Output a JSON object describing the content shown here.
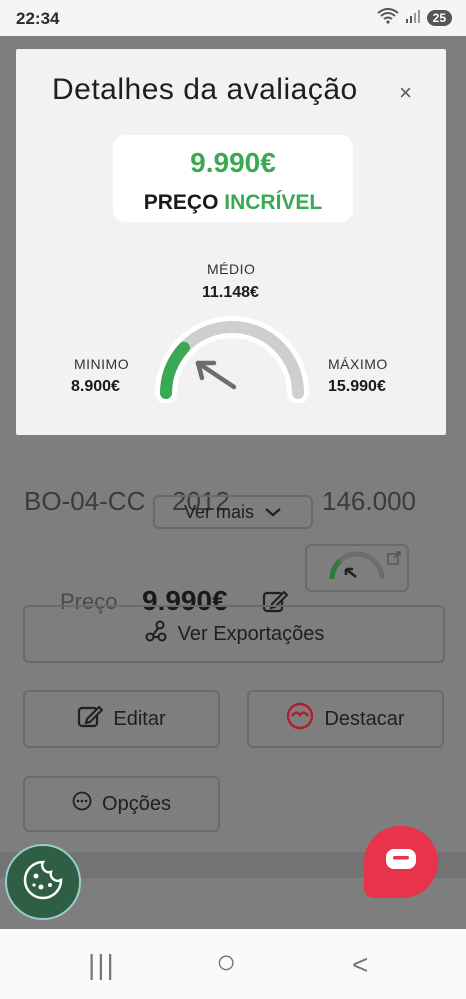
{
  "status": {
    "time": "22:34",
    "battery": "25"
  },
  "background": {
    "row_left": "BO-04-CC",
    "row_mid": "2012",
    "row_right": "146.000",
    "ver_mais": "Ver mais",
    "preco_label": "Preço",
    "preco_value": "9.990€",
    "ver_exportacoes": "Ver Exportações",
    "editar": "Editar",
    "destacar": "Destacar",
    "opcoes": "Opções"
  },
  "modal": {
    "title": "Detalhes da avaliação",
    "close": "×",
    "price": "9.990€",
    "tag_prefix": "PREÇO",
    "tag_highlight": "INCRÍVEL",
    "medio_label": "MÉDIO",
    "medio_value": "11.148€",
    "min_label": "MINIMO",
    "min_value": "8.900€",
    "max_label": "MÁXIMO",
    "max_value": "15.990€",
    "gauge_fill_fraction": 0.24,
    "colors": {
      "accent": "#3aa953",
      "track": "#cfcfcf"
    }
  },
  "nav": {
    "recent": "|||",
    "home": "○",
    "back": "<"
  },
  "icons": {
    "close": "close-icon",
    "chevron": "chevron-down-icon",
    "edit": "edit-icon",
    "external": "external-link-icon",
    "exports": "share-icon",
    "destacar": "highlight-icon",
    "options": "more-icon",
    "chat": "chat-icon",
    "cookie": "cookie-icon"
  }
}
